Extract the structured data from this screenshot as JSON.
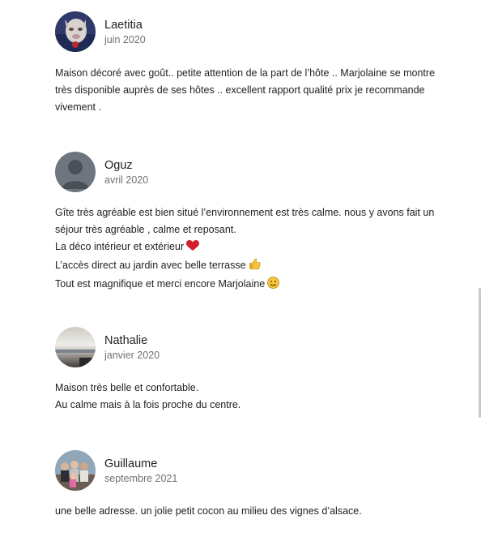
{
  "reviews": [
    {
      "name": "Laetitia",
      "date": "juin 2020",
      "lines": [
        "Maison décoré avec goût.. petite attention de la part de l’hôte .. Marjolaine se montre",
        "très disponible auprès de ses hôtes .. excellent rapport qualité prix je recommande",
        "vivement ."
      ]
    },
    {
      "name": "Oguz",
      "date": "avril 2020",
      "lines": [
        "Gîte très agréable est bien situé l’environnement est très calme. nous y avons fait un",
        "séjour très agréable , calme et reposant.",
        "La déco intérieur et extérieur",
        "L’accès direct au jardin avec belle terrasse",
        "Tout est magnifique et merci encore Marjolaine"
      ]
    },
    {
      "name": "Nathalie",
      "date": "janvier 2020",
      "lines": [
        "Maison très belle et confortable.",
        "Au calme mais à la fois proche du centre."
      ]
    },
    {
      "name": "Guillaume",
      "date": "septembre 2021",
      "lines": [
        "une belle adresse. un jolie petit cocon au milieu des vignes d’alsace."
      ]
    }
  ],
  "icons": {
    "heart": "heart-icon",
    "thumbs_up": "thumbs-up-icon",
    "smile": "smiling-face-icon"
  }
}
